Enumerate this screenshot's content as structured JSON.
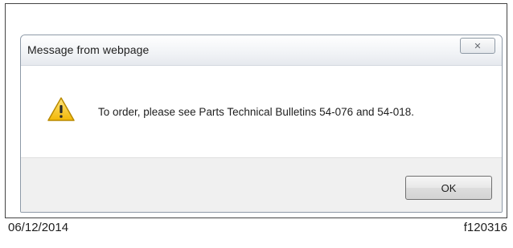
{
  "dialog": {
    "title": "Message from webpage",
    "close_glyph": "✕",
    "message": "To order, please see Parts Technical Bulletins 54-076 and 54-018.",
    "ok_label": "OK",
    "icon": "warning-icon"
  },
  "caption": {
    "date": "06/12/2014",
    "figure_id": "f120316"
  },
  "colors": {
    "warning_fill": "#f5c21b",
    "warning_stroke": "#b98a00",
    "dialog_border": "#8e9aa8"
  }
}
